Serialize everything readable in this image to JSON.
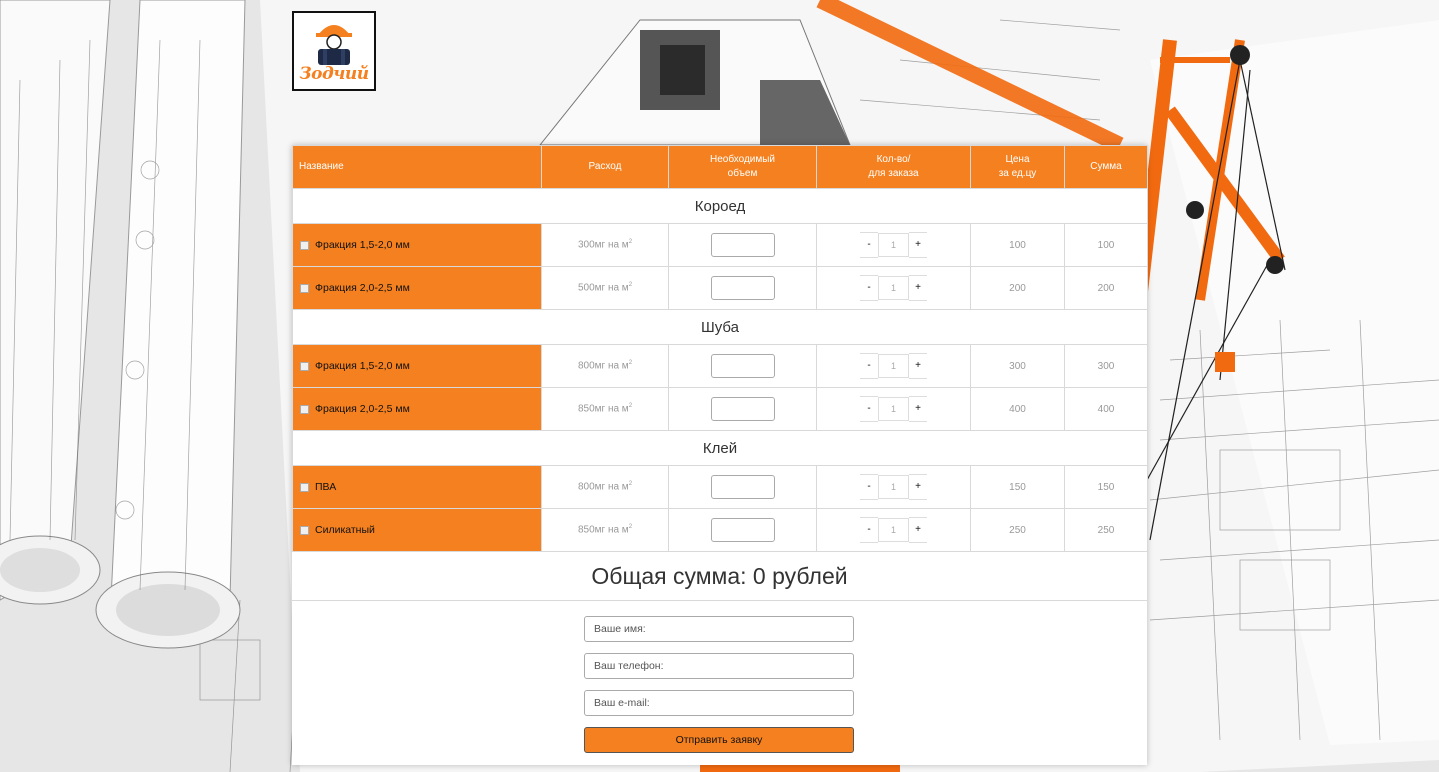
{
  "brand": {
    "logo_text": "Зодчий",
    "accent_color": "#f5801f"
  },
  "table": {
    "headers": {
      "name": "Название",
      "consumption": "Расход",
      "volume_line1": "Необходимый",
      "volume_line2": "объем",
      "qty_line1": "Кол-во/",
      "qty_line2": "для заказа",
      "price_line1": "Цена",
      "price_line2": "за ед.цу",
      "sum": "Сумма"
    },
    "groups": [
      {
        "title": "Короед",
        "items": [
          {
            "name": "Фракция 1,5-2,0 мм",
            "consumption": "300мг на м",
            "qty": "1",
            "price": "100",
            "sum": "100"
          },
          {
            "name": "Фракция 2,0-2,5 мм",
            "consumption": "500мг на м",
            "qty": "1",
            "price": "200",
            "sum": "200"
          }
        ]
      },
      {
        "title": "Шуба",
        "items": [
          {
            "name": "Фракция 1,5-2,0 мм",
            "consumption": "800мг на м",
            "qty": "1",
            "price": "300",
            "sum": "300"
          },
          {
            "name": "Фракция 2,0-2,5 мм",
            "consumption": "850мг на м",
            "qty": "1",
            "price": "400",
            "sum": "400"
          }
        ]
      },
      {
        "title": "Клей",
        "items": [
          {
            "name": "ПВА",
            "consumption": "800мг на м",
            "qty": "1",
            "price": "150",
            "sum": "150"
          },
          {
            "name": "Силикатный",
            "consumption": "850мг на м",
            "qty": "1",
            "price": "250",
            "sum": "250"
          }
        ]
      }
    ],
    "unit_sup": "2",
    "minus": "-",
    "plus": "+"
  },
  "total": {
    "label": "Общая сумма: 0 рублей"
  },
  "form": {
    "name_placeholder": "Ваше имя:",
    "phone_placeholder": "Ваш телефон:",
    "email_placeholder": "Ваш e-mail:",
    "submit_label": "Отправить заявку"
  }
}
